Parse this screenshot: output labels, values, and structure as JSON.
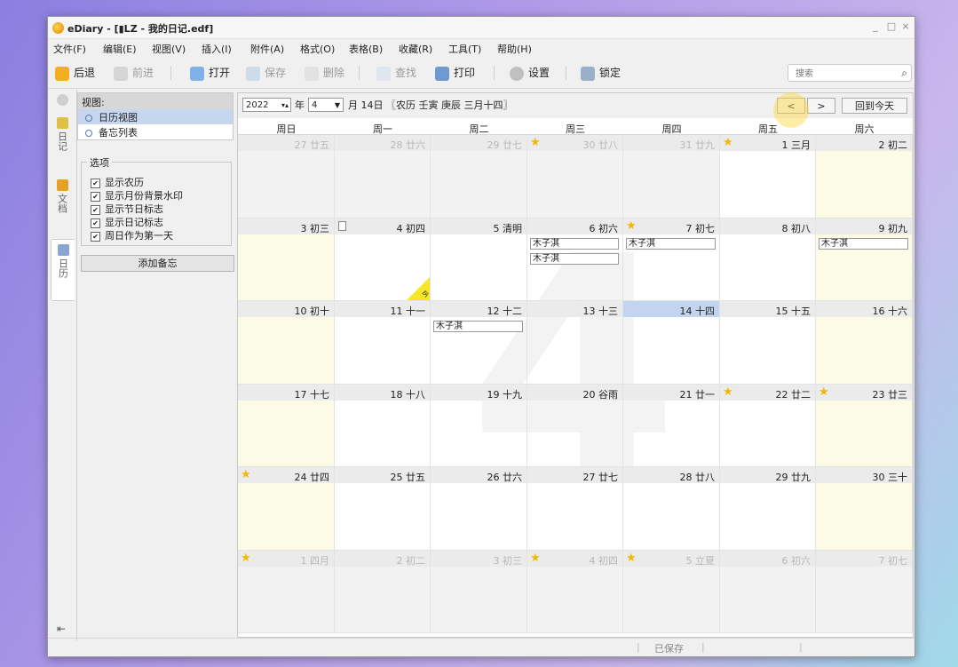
{
  "window": {
    "title": "eDiary - [▮LZ - 我的日记.edf]",
    "controls": [
      "_",
      "□",
      "×"
    ]
  },
  "menu": [
    "文件(F)",
    "编辑(E)",
    "视图(V)",
    "插入(I)",
    "附件(A)",
    "格式(O)",
    "表格(B)",
    "收藏(R)",
    "工具(T)",
    "帮助(H)"
  ],
  "toolbar": {
    "back": "后退",
    "forward": "前进",
    "open": "打开",
    "save": "保存",
    "delete": "删除",
    "find": "查找",
    "print": "打印",
    "settings": "设置",
    "lock": "锁定",
    "search_placeholder": "搜索"
  },
  "left_tabs": {
    "diary": "日记",
    "docs": "文档",
    "calendar": "日历"
  },
  "sidebar": {
    "view_header": "视图:",
    "views": [
      "日历视图",
      "备忘列表"
    ],
    "options_title": "选项",
    "options": [
      "显示农历",
      "显示月份背景水印",
      "显示节日标志",
      "显示日记标志",
      "周日作为第一天"
    ],
    "add_memo": "添加备忘"
  },
  "calendar": {
    "year": "2022",
    "year_label": "年",
    "month": "4",
    "date_text": "月 14日 〖农历 壬寅 庚辰 三月十四〗",
    "prev": "<",
    "next": ">",
    "today_btn": "回到今天",
    "watermark": "4",
    "weekdays": [
      "周日",
      "周一",
      "周二",
      "周三",
      "周四",
      "周五",
      "周六"
    ],
    "today_mark": "今",
    "days": [
      {
        "label": "27 廿五",
        "other": true
      },
      {
        "label": "28 廿六",
        "other": true
      },
      {
        "label": "29 廿七",
        "other": true
      },
      {
        "label": "30 廿八",
        "other": true,
        "star": true
      },
      {
        "label": "31 廿九",
        "other": true
      },
      {
        "label": "1 三月",
        "star": true
      },
      {
        "label": "2 初二"
      },
      {
        "label": "3 初三"
      },
      {
        "label": "4 初四",
        "note": true,
        "today_mark": true
      },
      {
        "label": "5 清明"
      },
      {
        "label": "6 初六",
        "entries": [
          "木子淇",
          "木子淇"
        ]
      },
      {
        "label": "7 初七",
        "star": true,
        "entries": [
          "木子淇"
        ]
      },
      {
        "label": "8 初八"
      },
      {
        "label": "9 初九",
        "entries": [
          "木子淇"
        ]
      },
      {
        "label": "10 初十"
      },
      {
        "label": "11 十一"
      },
      {
        "label": "12 十二",
        "entries": [
          "木子淇"
        ]
      },
      {
        "label": "13 十三"
      },
      {
        "label": "14 十四",
        "today": true
      },
      {
        "label": "15 十五"
      },
      {
        "label": "16 十六"
      },
      {
        "label": "17 十七"
      },
      {
        "label": "18 十八"
      },
      {
        "label": "19 十九"
      },
      {
        "label": "20 谷雨"
      },
      {
        "label": "21 廿一"
      },
      {
        "label": "22 廿二",
        "star": true
      },
      {
        "label": "23 廿三",
        "star": true
      },
      {
        "label": "24 廿四",
        "star": true
      },
      {
        "label": "25 廿五"
      },
      {
        "label": "26 廿六"
      },
      {
        "label": "27 廿七"
      },
      {
        "label": "28 廿八"
      },
      {
        "label": "29 廿九"
      },
      {
        "label": "30 三十"
      },
      {
        "label": "1 四月",
        "other": true,
        "star": true
      },
      {
        "label": "2 初二",
        "other": true
      },
      {
        "label": "3 初三",
        "other": true
      },
      {
        "label": "4 初四",
        "other": true,
        "star": true
      },
      {
        "label": "5 立夏",
        "other": true,
        "star": true
      },
      {
        "label": "6 初六",
        "other": true
      },
      {
        "label": "7 初七",
        "other": true
      }
    ]
  },
  "status": {
    "saved": "已保存"
  },
  "colors": {
    "today_highlight": "#c3d5ee",
    "weekend_bg": "#fbfbe6",
    "star": "#f0b800"
  }
}
